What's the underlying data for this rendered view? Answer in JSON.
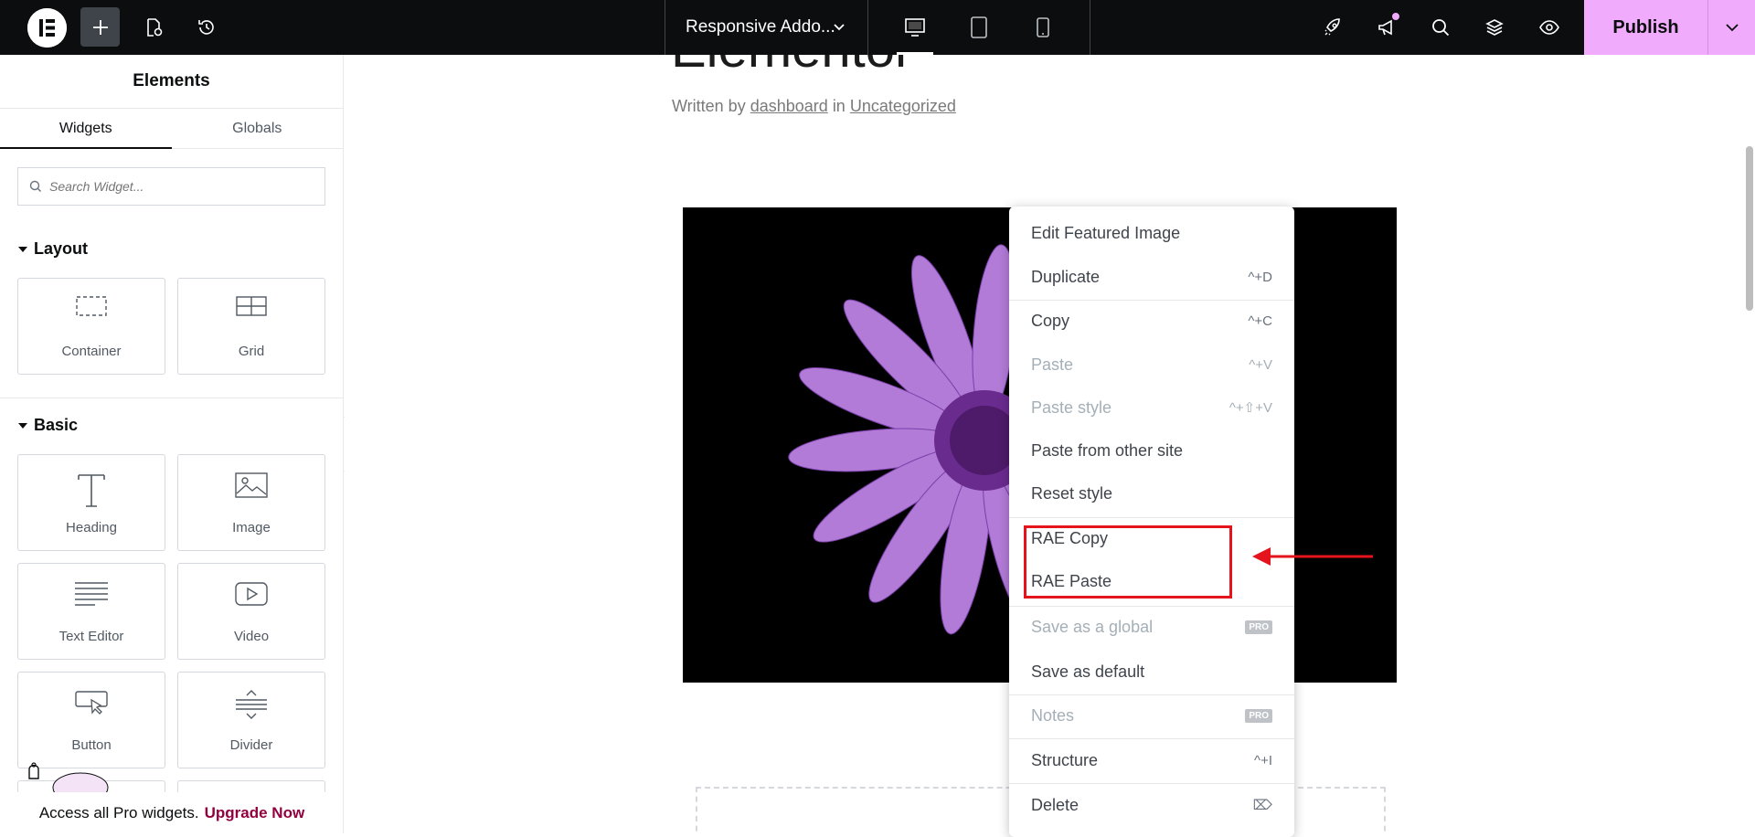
{
  "topbar": {
    "document_title": "Responsive Addo...",
    "publish_label": "Publish",
    "colors": {
      "background": "#0c0d0e",
      "publish": "#f0abfc"
    },
    "icons": [
      "elementor-logo-icon",
      "plus-icon",
      "page-settings-icon",
      "history-icon",
      "chevron-down-icon",
      "desktop-icon",
      "tablet-icon",
      "mobile-icon",
      "rocket-icon",
      "megaphone-icon",
      "search-icon",
      "layers-icon",
      "eye-icon",
      "chevron-down-icon"
    ]
  },
  "panel": {
    "title": "Elements",
    "tabs": [
      "Widgets",
      "Globals"
    ],
    "search_placeholder": "Search Widget...",
    "categories": {
      "layout": {
        "label": "Layout",
        "widgets": [
          "Container",
          "Grid"
        ]
      },
      "basic": {
        "label": "Basic",
        "widgets": [
          "Heading",
          "Image",
          "Text Editor",
          "Video",
          "Button",
          "Divider"
        ]
      }
    },
    "upgrade": {
      "text": "Access all Pro widgets.",
      "link": "Upgrade Now"
    }
  },
  "canvas": {
    "title": "Elementor",
    "meta": {
      "prefix": "Written by",
      "author": "dashboard",
      "in": "in",
      "category": "Uncategorized"
    }
  },
  "context_menu": {
    "items": {
      "edit_featured": {
        "label": "Edit Featured Image",
        "shortcut": ""
      },
      "duplicate": {
        "label": "Duplicate",
        "shortcut": "^+D"
      },
      "copy": {
        "label": "Copy",
        "shortcut": "^+C"
      },
      "paste": {
        "label": "Paste",
        "shortcut": "^+V"
      },
      "paste_style": {
        "label": "Paste style",
        "shortcut": "^+⇧+V"
      },
      "paste_other": {
        "label": "Paste from other site",
        "shortcut": ""
      },
      "reset_style": {
        "label": "Reset style",
        "shortcut": ""
      },
      "rae_copy": {
        "label": "RAE Copy",
        "shortcut": ""
      },
      "rae_paste": {
        "label": "RAE Paste",
        "shortcut": ""
      },
      "save_global": {
        "label": "Save as a global",
        "badge": "PRO"
      },
      "save_default": {
        "label": "Save as default",
        "shortcut": ""
      },
      "notes": {
        "label": "Notes",
        "badge": "PRO"
      },
      "structure": {
        "label": "Structure",
        "shortcut": "^+I"
      },
      "delete": {
        "label": "Delete",
        "shortcut": "⌦"
      }
    },
    "highlight_color": "#e5141c"
  }
}
